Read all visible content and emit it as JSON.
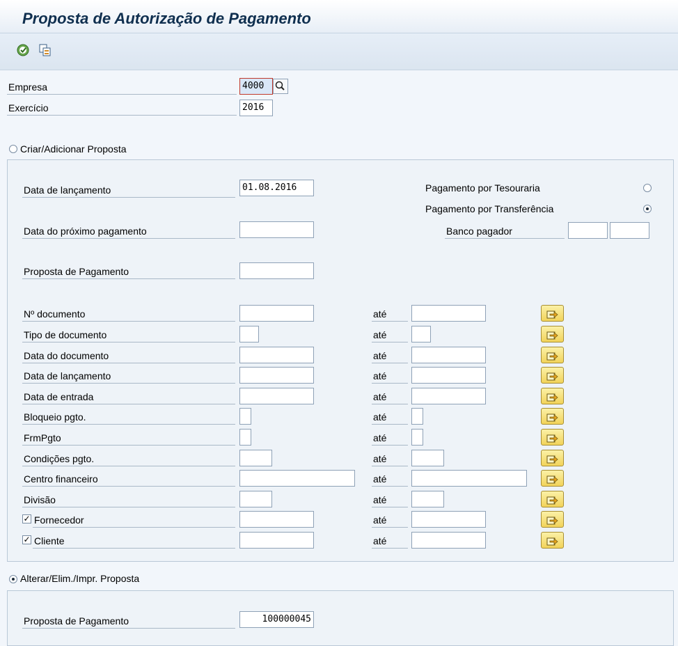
{
  "title": "Proposta de Autorização de Pagamento",
  "toolbar": {
    "execute_icon": "execute-icon",
    "copy_icon": "copy-icon"
  },
  "header": {
    "empresa_label": "Empresa",
    "empresa_value": "4000",
    "exercicio_label": "Exercício",
    "exercicio_value": "2016"
  },
  "create": {
    "radio_label": "Criar/Adicionar Proposta",
    "data_lancamento_label": "Data de lançamento",
    "data_lancamento_value": "01.08.2016",
    "data_proximo_label": "Data do próximo pagamento",
    "data_proximo_value": "",
    "proposta_label": "Proposta de Pagamento",
    "proposta_value": "",
    "tesouraria_label": "Pagamento por Tesouraria",
    "transferencia_label": "Pagamento por Transferência",
    "banco_label": "Banco pagador",
    "banco_value1": "",
    "banco_value2": "",
    "ranges": [
      {
        "label": "Nº documento",
        "to_label": "até",
        "from": "",
        "to": ""
      },
      {
        "label": "Tipo de documento",
        "to_label": "até",
        "from": "",
        "to": ""
      },
      {
        "label": "Data do documento",
        "to_label": "até",
        "from": "",
        "to": ""
      },
      {
        "label": "Data de lançamento",
        "to_label": "até",
        "from": "",
        "to": ""
      },
      {
        "label": "Data de entrada",
        "to_label": "até",
        "from": "",
        "to": ""
      },
      {
        "label": "Bloqueio pgto.",
        "to_label": "até",
        "from": "",
        "to": ""
      },
      {
        "label": "FrmPgto",
        "to_label": "até",
        "from": "",
        "to": ""
      },
      {
        "label": "Condições pgto.",
        "to_label": "até",
        "from": "",
        "to": ""
      },
      {
        "label": "Centro financeiro",
        "to_label": "até",
        "from": "",
        "to": ""
      },
      {
        "label": "Divisão",
        "to_label": "até",
        "from": "",
        "to": ""
      },
      {
        "label": "Fornecedor",
        "to_label": "até",
        "from": "",
        "to": ""
      },
      {
        "label": "Cliente",
        "to_label": "até",
        "from": "",
        "to": ""
      }
    ]
  },
  "change": {
    "radio_label": "Alterar/Elim./Impr. Proposta",
    "proposta_label": "Proposta de Pagamento",
    "proposta_value": "100000045"
  },
  "colors": {
    "title": "#0f2f4f",
    "background": "#f2f6fb",
    "multisel_button": "#f2d35a"
  }
}
